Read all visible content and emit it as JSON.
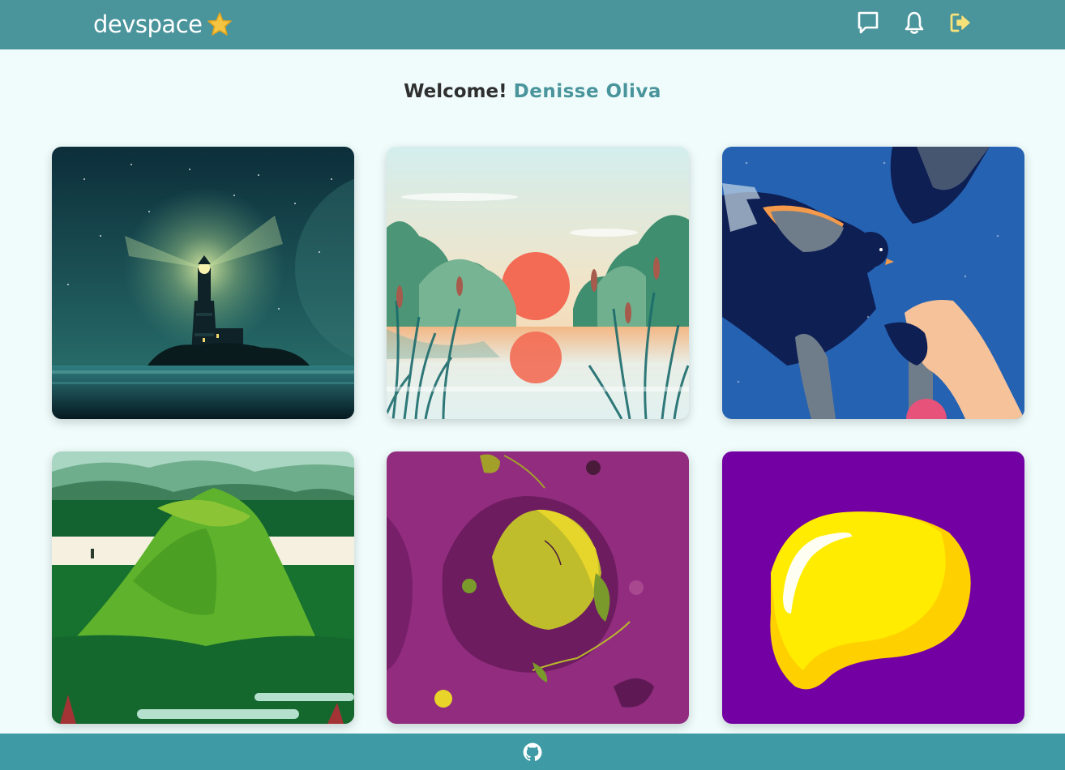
{
  "app": {
    "brand": "devspace",
    "brand_icon": "star-icon"
  },
  "header": {
    "icons": [
      {
        "name": "chat-icon",
        "color": "#ffffff"
      },
      {
        "name": "bell-icon",
        "color": "#ffffff"
      },
      {
        "name": "logout-icon",
        "color": "#f7e27a"
      }
    ]
  },
  "welcome": {
    "greeting": "Welcome!",
    "user_name": "Denisse Oliva"
  },
  "gallery": {
    "items": [
      {
        "name": "lighthouse-night"
      },
      {
        "name": "lake-sunset"
      },
      {
        "name": "bird-and-hand"
      },
      {
        "name": "green-volcano"
      },
      {
        "name": "purple-lemon"
      },
      {
        "name": "yellow-blob"
      }
    ]
  },
  "footer": {
    "icon": "github-icon"
  },
  "colors": {
    "navbar": "#4a949c",
    "background": "#effcfb",
    "footer": "#3e9ba6",
    "accent": "#4a949c"
  }
}
